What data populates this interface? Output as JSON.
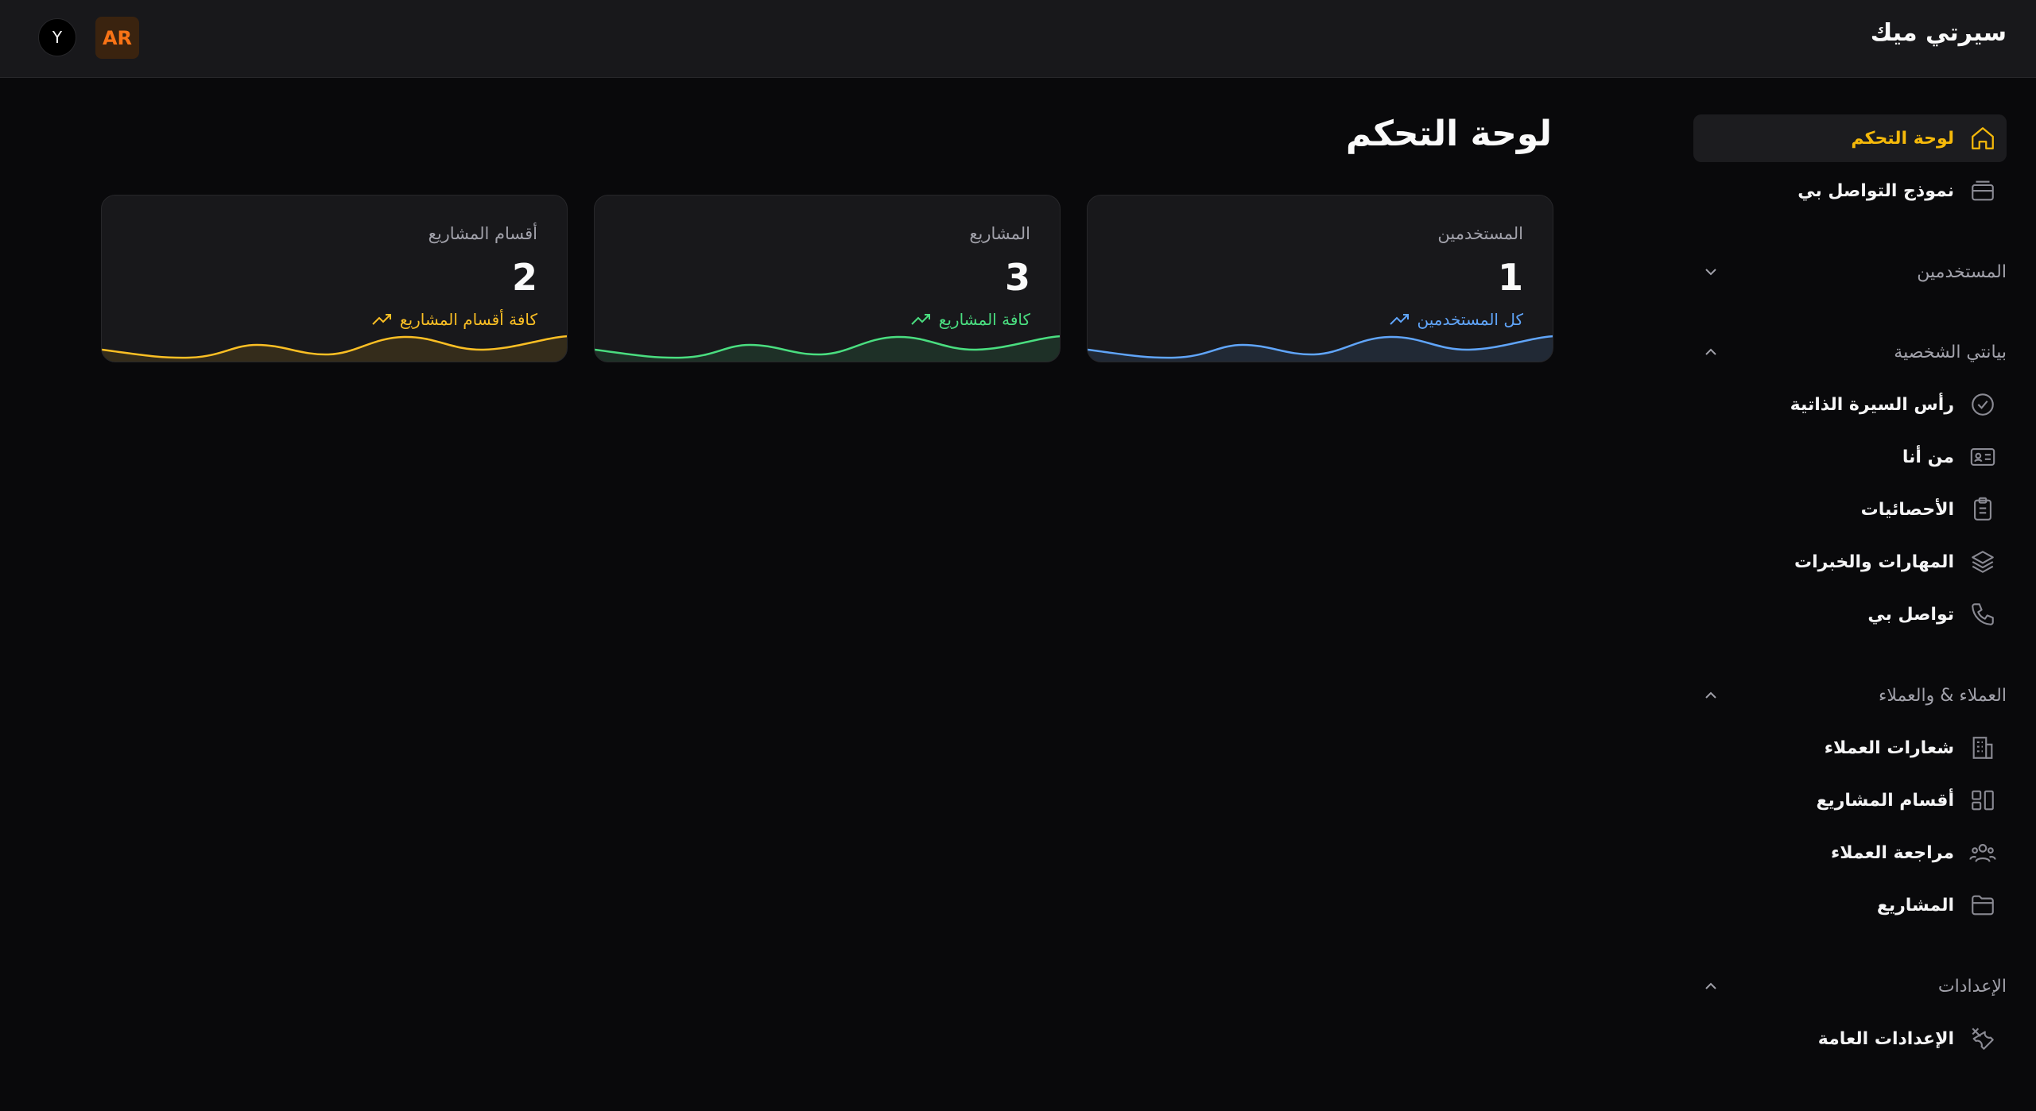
{
  "app": {
    "brand": "سيرتي ميك",
    "lang_button": "AR",
    "avatar_initial": "Y"
  },
  "page": {
    "title": "لوحة التحكم"
  },
  "colors": {
    "accent": "#f5b90a",
    "green": "#22c55e",
    "blue": "#3b82f6",
    "orange": "#f97316"
  },
  "sidebar": {
    "top_items": [
      {
        "label": "لوحة التحكم",
        "icon": "home-icon",
        "active": true
      },
      {
        "label": "نموذج التواصل بي",
        "icon": "inbox-icon",
        "active": false
      }
    ],
    "sections": [
      {
        "label": "المستخدمين",
        "expanded": false,
        "items": []
      },
      {
        "label": "بيانتي الشخصية",
        "expanded": true,
        "items": [
          {
            "label": "رأس السيرة الذاتية",
            "icon": "badge-check-icon"
          },
          {
            "label": "من أنا",
            "icon": "id-card-icon"
          },
          {
            "label": "الأحصائيات",
            "icon": "clipboard-icon"
          },
          {
            "label": "المهارات والخبرات",
            "icon": "layers-icon"
          },
          {
            "label": "تواصل بي",
            "icon": "phone-icon"
          }
        ]
      },
      {
        "label": "العملاء & والعملاء",
        "expanded": true,
        "items": [
          {
            "label": "شعارات العملاء",
            "icon": "building-icon"
          },
          {
            "label": "أقسام المشاريع",
            "icon": "layout-icon"
          },
          {
            "label": "مراجعة العملاء",
            "icon": "users-icon"
          },
          {
            "label": "المشاريع",
            "icon": "folder-icon"
          }
        ]
      },
      {
        "label": "الإعدادات",
        "expanded": true,
        "items": [
          {
            "label": "الإعدادات العامة",
            "icon": "tools-icon"
          }
        ]
      }
    ]
  },
  "cards": [
    {
      "title": "المستخدمين",
      "value": "1",
      "link": "كل المستخدمين",
      "color": "#60a5fa"
    },
    {
      "title": "المشاريع",
      "value": "3",
      "link": "كافة المشاريع",
      "color": "#4ade80"
    },
    {
      "title": "أقسام المشاريع",
      "value": "2",
      "link": "كافة أقسام المشاريع",
      "color": "#fbbf24"
    }
  ]
}
